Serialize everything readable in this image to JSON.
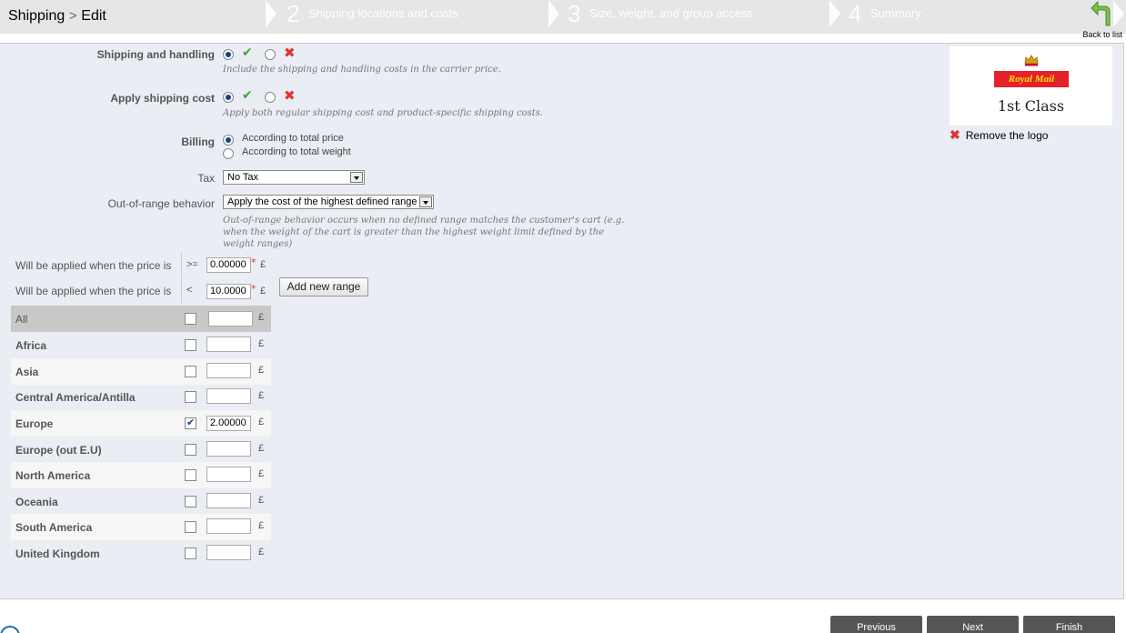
{
  "header": {
    "breadcrumb": [
      "Shipping",
      "Edit"
    ],
    "steps": [
      {
        "num": "2",
        "label": "Shipping locations and costs"
      },
      {
        "num": "3",
        "label": "Size, weight, and group access"
      },
      {
        "num": "4",
        "label": "Summary"
      }
    ],
    "back_label": "Back to list"
  },
  "form": {
    "shipping_handling": {
      "label": "Shipping and handling",
      "value": "yes",
      "hint": "Include the shipping and handling costs in the carrier price."
    },
    "apply_shipping_cost": {
      "label": "Apply shipping cost",
      "value": "yes",
      "hint": "Apply both regular shipping cost and product-specific shipping costs."
    },
    "billing": {
      "label": "Billing",
      "options": [
        "According to total price",
        "According to total weight"
      ],
      "selected": "According to total price"
    },
    "tax": {
      "label": "Tax",
      "value": "No Tax"
    },
    "out_of_range": {
      "label": "Out-of-range behavior",
      "value": "Apply the cost of the highest defined range",
      "hint": "Out-of-range behavior occurs when no defined range matches the customer's cart (e.g. when the weight of the cart is greater than the highest weight limit defined by the weight ranges)"
    }
  },
  "ranges": {
    "rows": [
      {
        "label": "Will be applied when the price is",
        "op": ">=",
        "value": "0.00000",
        "currency": "£"
      },
      {
        "label": "Will be applied when the price is",
        "op": "<",
        "value": "10.0000",
        "currency": "£"
      }
    ],
    "add_label": "Add new range",
    "required_mark": "*"
  },
  "zones": [
    {
      "name": "All",
      "checked": false,
      "value": "",
      "currency": "£"
    },
    {
      "name": "Africa",
      "checked": false,
      "value": "",
      "currency": "£"
    },
    {
      "name": "Asia",
      "checked": false,
      "value": "",
      "currency": "£"
    },
    {
      "name": "Central America/Antilla",
      "checked": false,
      "value": "",
      "currency": "£"
    },
    {
      "name": "Europe",
      "checked": true,
      "value": "2.00000",
      "currency": "£"
    },
    {
      "name": "Europe (out E.U)",
      "checked": false,
      "value": "",
      "currency": "£"
    },
    {
      "name": "North America",
      "checked": false,
      "value": "",
      "currency": "£"
    },
    {
      "name": "Oceania",
      "checked": false,
      "value": "",
      "currency": "£"
    },
    {
      "name": "South America",
      "checked": false,
      "value": "",
      "currency": "£"
    },
    {
      "name": "United Kingdom",
      "checked": false,
      "value": "",
      "currency": "£"
    }
  ],
  "logo": {
    "brand": "Royal Mail",
    "caption": "1st Class",
    "remove_label": "Remove the logo"
  },
  "footer": {
    "previous": "Previous",
    "next": "Next",
    "finish": "Finish"
  },
  "colors": {
    "accent": "#1a3f8b",
    "ok": "#3da33a",
    "no": "#e03333",
    "panel": "#eaedf4",
    "brand_red": "#e4202a",
    "brand_yellow": "#fde000"
  }
}
